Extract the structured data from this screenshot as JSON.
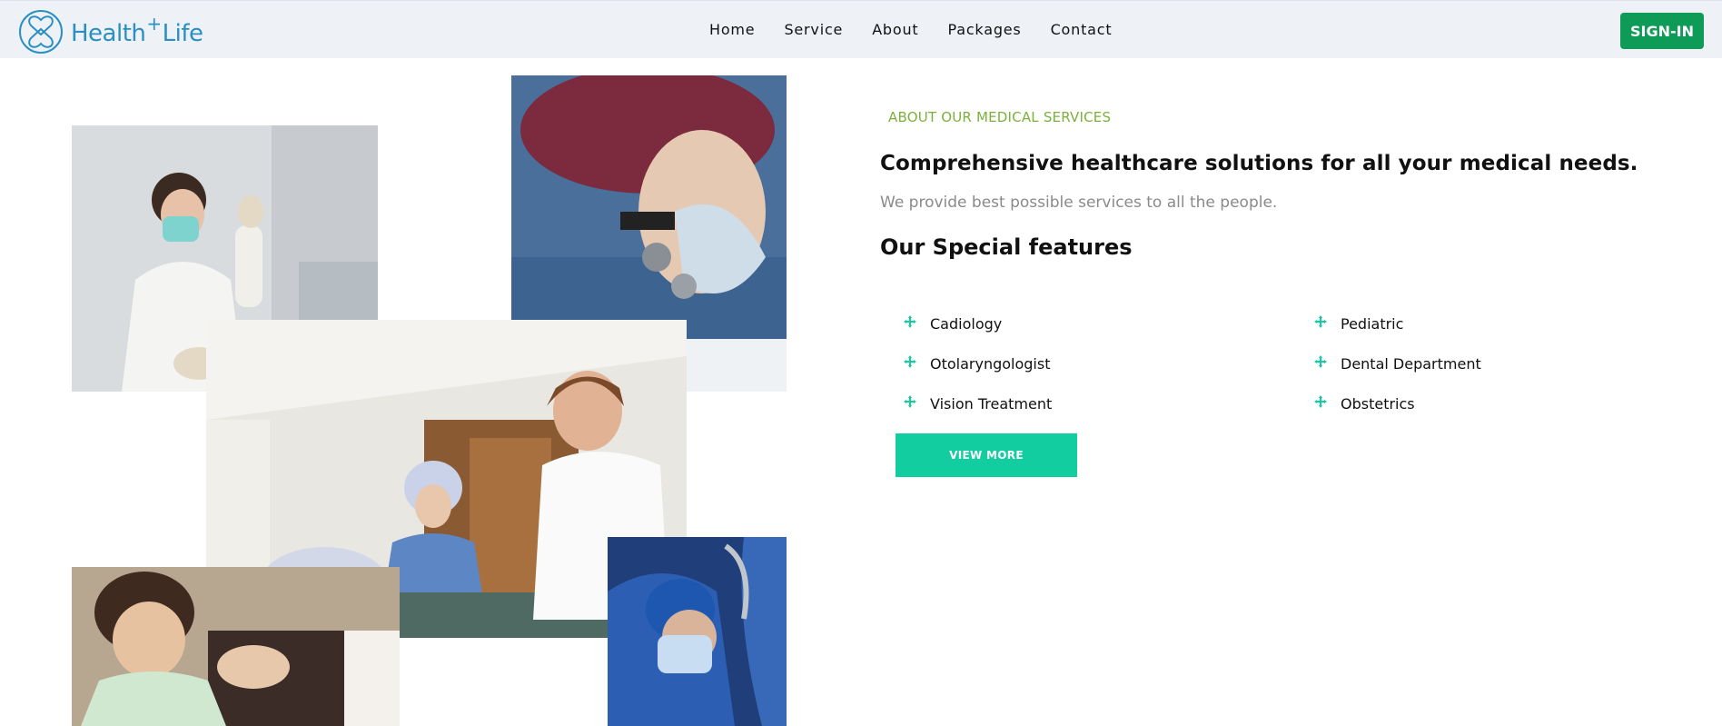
{
  "brand": {
    "name_left": "Health",
    "plus": "+",
    "name_right": "Life",
    "accent": "#2a8fc2"
  },
  "nav": {
    "items": [
      "Home",
      "Service",
      "About",
      "Packages",
      "Contact"
    ]
  },
  "header": {
    "signin_label": "SIGN-IN",
    "signin_color": "#0e9b57"
  },
  "about": {
    "eyebrow": "ABOUT OUR MEDICAL SERVICES",
    "headline": "Comprehensive healthcare solutions for all your medical needs.",
    "subtext": "We provide best possible services to all the people.",
    "features_title": "Our Special features",
    "features": [
      "Cadiology",
      "Otolaryngologist",
      "Vision Treatment",
      "Pediatric",
      "Dental Department",
      "Obstetrics"
    ],
    "feature_icon": "move-arrows-icon",
    "view_more_label": "VIEW MORE",
    "button_color": "#12cda0",
    "eyebrow_color": "#7bb13a"
  }
}
